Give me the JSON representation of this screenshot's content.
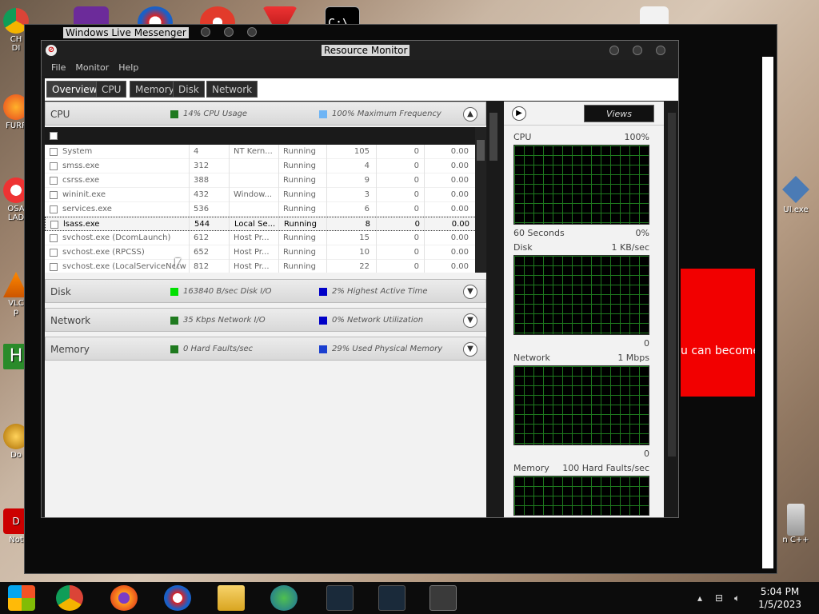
{
  "desktop": {
    "icons": [
      "CH\nDI",
      "FURF",
      "OSA\nLAD",
      "VLC\np",
      "H",
      "Do",
      "D\nC\nNot"
    ],
    "right_icons": [
      "UI.exe",
      "n C++"
    ]
  },
  "back_window": {
    "title": "Windows Live Messenger",
    "ad_text": "u can become"
  },
  "window": {
    "title": "Resource Monitor",
    "menu": [
      "File",
      "Monitor",
      "Help"
    ],
    "tabs": [
      "Overview",
      "CPU",
      "Memory",
      "Disk",
      "Network"
    ]
  },
  "sections": {
    "cpu": {
      "name": "CPU",
      "stat1": "14% CPU Usage",
      "stat2": "100% Maximum Frequency",
      "color1": "#1f7a1f",
      "color2": "#6fb5f5"
    },
    "disk": {
      "name": "Disk",
      "stat1": "163840 B/sec Disk I/O",
      "stat2": "2% Highest Active Time",
      "color1": "#00e000",
      "color2": "#0000c8"
    },
    "network": {
      "name": "Network",
      "stat1": "35 Kbps Network I/O",
      "stat2": "0% Network Utilization",
      "color1": "#1f7a1f",
      "color2": "#0000c8"
    },
    "memory": {
      "name": "Memory",
      "stat1": "0 Hard Faults/sec",
      "stat2": "29% Used Physical Memory",
      "color1": "#1f7a1f",
      "color2": "#1b3fd0"
    }
  },
  "processes": [
    {
      "name": "System",
      "pid": "4",
      "desc": "NT Kern...",
      "status": "Running",
      "threads": "105",
      "cpu": "0",
      "avg": "0.00"
    },
    {
      "name": "smss.exe",
      "pid": "312",
      "desc": "",
      "status": "Running",
      "threads": "4",
      "cpu": "0",
      "avg": "0.00"
    },
    {
      "name": "csrss.exe",
      "pid": "388",
      "desc": "",
      "status": "Running",
      "threads": "9",
      "cpu": "0",
      "avg": "0.00"
    },
    {
      "name": "wininit.exe",
      "pid": "432",
      "desc": "Window...",
      "status": "Running",
      "threads": "3",
      "cpu": "0",
      "avg": "0.00"
    },
    {
      "name": "services.exe",
      "pid": "536",
      "desc": "",
      "status": "Running",
      "threads": "6",
      "cpu": "0",
      "avg": "0.00"
    },
    {
      "name": "lsass.exe",
      "pid": "544",
      "desc": "Local Se...",
      "status": "Running",
      "threads": "8",
      "cpu": "0",
      "avg": "0.00"
    },
    {
      "name": "svchost.exe (DcomLaunch)",
      "pid": "612",
      "desc": "Host Pr...",
      "status": "Running",
      "threads": "15",
      "cpu": "0",
      "avg": "0.00"
    },
    {
      "name": "svchost.exe (RPCSS)",
      "pid": "652",
      "desc": "Host Pr...",
      "status": "Running",
      "threads": "10",
      "cpu": "0",
      "avg": "0.00"
    },
    {
      "name": "svchost.exe (LocalServiceNetw...",
      "pid": "812",
      "desc": "Host Pr...",
      "status": "Running",
      "threads": "22",
      "cpu": "0",
      "avg": "0.00"
    }
  ],
  "selected_process_index": 5,
  "graphs": {
    "views_label": "Views",
    "cpu": {
      "label": "CPU",
      "max": "100%",
      "footer_left": "60 Seconds",
      "footer_right": "0%"
    },
    "disk": {
      "label": "Disk",
      "max": "1 KB/sec",
      "footer_right": "0"
    },
    "network": {
      "label": "Network",
      "max": "1 Mbps",
      "footer_right": "0"
    },
    "memory": {
      "label": "Memory",
      "max": "100 Hard Faults/sec"
    }
  },
  "taskbar": {
    "time": "5:04 PM",
    "date": "1/5/2023"
  }
}
